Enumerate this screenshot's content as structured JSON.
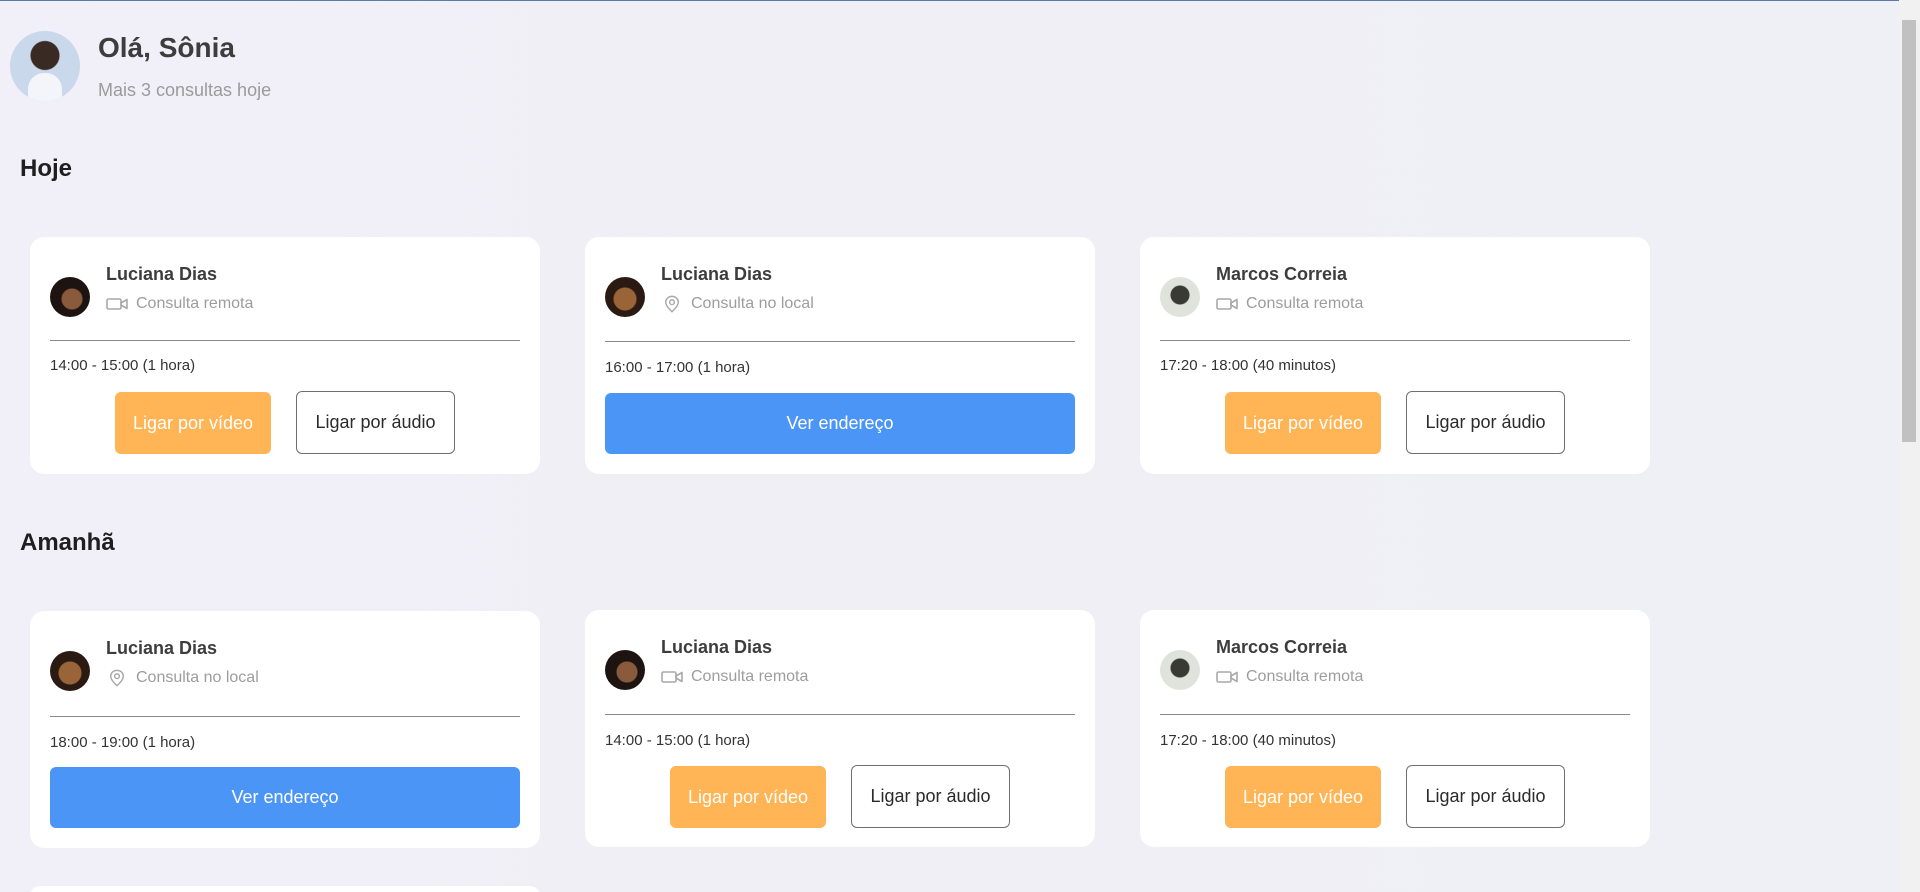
{
  "header": {
    "greeting": "Olá, Sônia",
    "subtitle": "Mais 3 consultas hoje"
  },
  "sections": {
    "today": {
      "title": "Hoje",
      "cards": [
        {
          "name": "Luciana Dias",
          "type": "Consulta remota",
          "type_icon": "video-camera-icon",
          "time": "14:00 - 15:00 (1 hora)",
          "video_label": "Ligar por vídeo",
          "audio_label": "Ligar por áudio"
        },
        {
          "name": "Luciana Dias",
          "type": "Consulta no local",
          "type_icon": "location-pin-icon",
          "time": "16:00 - 17:00 (1 hora)",
          "address_label": "Ver endereço"
        },
        {
          "name": "Marcos Correia",
          "type": "Consulta remota",
          "type_icon": "video-camera-icon",
          "time": "17:20 - 18:00 (40 minutos)",
          "video_label": "Ligar por vídeo",
          "audio_label": "Ligar por áudio"
        }
      ]
    },
    "tomorrow": {
      "title": "Amanhã",
      "cards": [
        {
          "name": "Luciana Dias",
          "type": "Consulta no local",
          "type_icon": "location-pin-icon",
          "time": "18:00 - 19:00 (1 hora)",
          "address_label": "Ver endereço"
        },
        {
          "name": "Luciana Dias",
          "type": "Consulta remota",
          "type_icon": "video-camera-icon",
          "time": "14:00 - 15:00 (1 hora)",
          "video_label": "Ligar por vídeo",
          "audio_label": "Ligar por áudio"
        },
        {
          "name": "Marcos Correia",
          "type": "Consulta remota",
          "type_icon": "video-camera-icon",
          "time": "17:20 - 18:00 (40 minutos)",
          "video_label": "Ligar por vídeo",
          "audio_label": "Ligar por áudio"
        }
      ]
    }
  },
  "colors": {
    "video_button": "#ffb455",
    "address_button": "#4a95f6",
    "background": "#f0eff6"
  }
}
